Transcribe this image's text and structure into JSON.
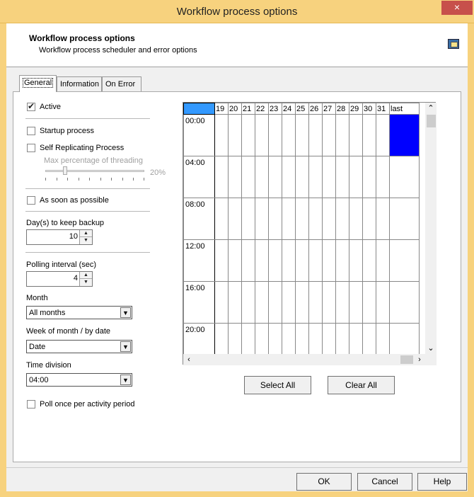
{
  "window": {
    "title": "Workflow process options",
    "close_glyph": "×"
  },
  "header": {
    "title": "Workflow process options",
    "subtitle": "Workflow process scheduler and error options",
    "icon": "app-window-icon"
  },
  "tabs": [
    {
      "label": "General",
      "active": true
    },
    {
      "label": "Information",
      "active": false
    },
    {
      "label": "On Error",
      "active": false
    }
  ],
  "general": {
    "active": {
      "label": "Active",
      "checked": true
    },
    "startup_process": {
      "label": "Startup process",
      "checked": false
    },
    "self_replicating": {
      "label": "Self Replicating Process",
      "checked": false
    },
    "threading": {
      "label": "Max percentage of threading",
      "value_text": "20%",
      "value_fraction": 0.2
    },
    "asap": {
      "label": "As soon as possible",
      "checked": false
    },
    "backup_days": {
      "label": "Day(s) to keep backup",
      "value": "10"
    },
    "polling": {
      "label": "Polling interval (sec)",
      "value": "4"
    },
    "month": {
      "label": "Month",
      "value": "All months"
    },
    "week": {
      "label": "Week of month / by date",
      "value": "Date"
    },
    "time_division": {
      "label": "Time division",
      "value": "04:00"
    },
    "poll_once": {
      "label": "Poll once per activity period",
      "checked": false
    }
  },
  "schedule": {
    "columns": [
      "19",
      "20",
      "21",
      "22",
      "23",
      "24",
      "25",
      "26",
      "27",
      "28",
      "29",
      "30",
      "31",
      "last"
    ],
    "rows": [
      "00:00",
      "04:00",
      "08:00",
      "12:00",
      "16:00",
      "20:00"
    ],
    "selected_cells": [
      {
        "row": "00:00",
        "column": "last"
      }
    ],
    "selected_color": "#0000ff",
    "select_all_label": "Select All",
    "clear_all_label": "Clear All"
  },
  "footer": {
    "ok_label": "OK",
    "cancel_label": "Cancel",
    "help_label": "Help"
  },
  "colors": {
    "titlebar": "#f7d27e",
    "close": "#c7504b"
  }
}
